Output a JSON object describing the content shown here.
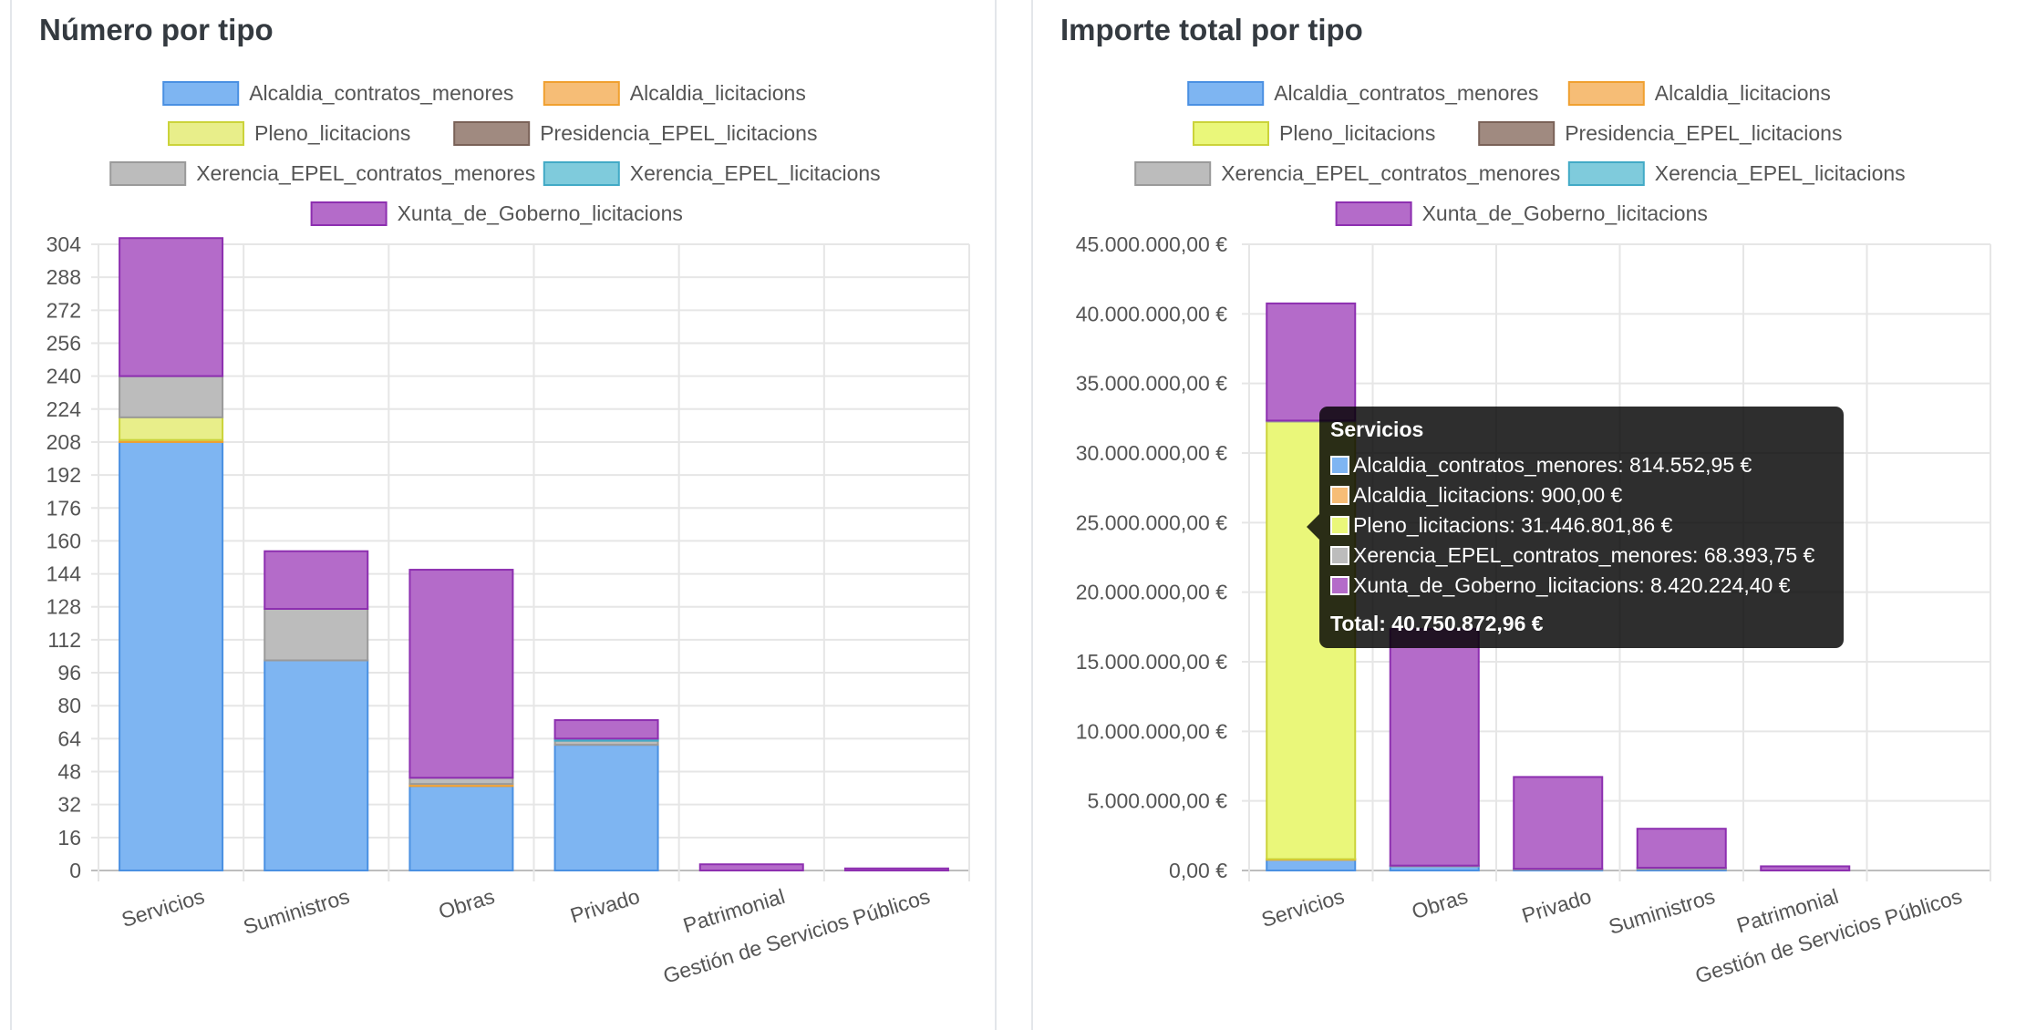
{
  "panels": {
    "left": {
      "title": "Número por tipo"
    },
    "right": {
      "title": "Importe total por tipo"
    }
  },
  "chart_data": [
    {
      "type": "bar",
      "stacked": true,
      "title": "Número por tipo",
      "categories": [
        "Servicios",
        "Suministros",
        "Obras",
        "Privado",
        "Patrimonial",
        "Gestión de Servicios Públicos"
      ],
      "ylim": [
        0,
        304
      ],
      "yticks": [
        0,
        16,
        32,
        48,
        64,
        80,
        96,
        112,
        128,
        144,
        160,
        176,
        192,
        208,
        224,
        240,
        256,
        272,
        288,
        304
      ],
      "y_tick_labels": [
        "0",
        "16",
        "32",
        "48",
        "64",
        "80",
        "96",
        "112",
        "128",
        "144",
        "160",
        "176",
        "192",
        "208",
        "224",
        "240",
        "256",
        "272",
        "288",
        "304"
      ],
      "grid": true,
      "legend_position": "top",
      "series": [
        {
          "name": "Alcaldia_contratos_menores",
          "color": "#7eb5f2",
          "border": "#4a90e2",
          "values": [
            208,
            102,
            41,
            61,
            0,
            0
          ]
        },
        {
          "name": "Alcaldia_licitacions",
          "color": "#f6bd76",
          "border": "#f0a030",
          "values": [
            1,
            0,
            1,
            0,
            0,
            0
          ]
        },
        {
          "name": "Pleno_licitacions",
          "color": "#e8ee8a",
          "border": "#cbd33a",
          "values": [
            11,
            0,
            0,
            0,
            0,
            0
          ]
        },
        {
          "name": "Presidencia_EPEL_licitacions",
          "color": "#a08a80",
          "border": "#7a6258",
          "values": [
            0,
            0,
            0,
            0,
            0,
            0
          ]
        },
        {
          "name": "Xerencia_EPEL_contratos_menores",
          "color": "#bcbcbc",
          "border": "#9a9a9a",
          "values": [
            20,
            25,
            3,
            2,
            0,
            0
          ]
        },
        {
          "name": "Xerencia_EPEL_licitacions",
          "color": "#7fcbdc",
          "border": "#42aac6",
          "values": [
            0,
            0,
            0,
            1,
            0,
            0
          ]
        },
        {
          "name": "Xunta_de_Goberno_licitacions",
          "color": "#b46bc9",
          "border": "#8d2fb0",
          "values": [
            67,
            28,
            101,
            9,
            3,
            1
          ]
        }
      ]
    },
    {
      "type": "bar",
      "stacked": true,
      "title": "Importe total por tipo",
      "categories": [
        "Servicios",
        "Obras",
        "Privado",
        "Suministros",
        "Patrimonial",
        "Gestión de Servicios Públicos"
      ],
      "ylim": [
        0,
        45000000
      ],
      "yticks": [
        0,
        5000000,
        10000000,
        15000000,
        20000000,
        25000000,
        30000000,
        35000000,
        40000000,
        45000000
      ],
      "y_tick_labels": [
        "0,00 €",
        "5.000.000,00 €",
        "10.000.000,00 €",
        "15.000.000,00 €",
        "20.000.000,00 €",
        "25.000.000,00 €",
        "30.000.000,00 €",
        "35.000.000,00 €",
        "40.000.000,00 €",
        "45.000.000,00 €"
      ],
      "grid": true,
      "legend_position": "top",
      "series": [
        {
          "name": "Alcaldia_contratos_menores",
          "color": "#7eb5f2",
          "border": "#4a90e2",
          "values": [
            814552.95,
            300000,
            100000,
            100000,
            0,
            0
          ]
        },
        {
          "name": "Alcaldia_licitacions",
          "color": "#f6bd76",
          "border": "#f0a030",
          "values": [
            900,
            0,
            0,
            0,
            0,
            0
          ]
        },
        {
          "name": "Pleno_licitacions",
          "color": "#eaf77a",
          "border": "#cbd33a",
          "values": [
            31446801.86,
            0,
            0,
            0,
            0,
            0
          ]
        },
        {
          "name": "Presidencia_EPEL_licitacions",
          "color": "#a08a80",
          "border": "#7a6258",
          "values": [
            0,
            0,
            0,
            0,
            0,
            0
          ]
        },
        {
          "name": "Xerencia_EPEL_contratos_menores",
          "color": "#bcbcbc",
          "border": "#9a9a9a",
          "values": [
            68393.75,
            50000,
            20000,
            100000,
            0,
            0
          ]
        },
        {
          "name": "Xerencia_EPEL_licitacions",
          "color": "#7fcbdc",
          "border": "#42aac6",
          "values": [
            0,
            0,
            0,
            0,
            0,
            0
          ]
        },
        {
          "name": "Xunta_de_Goberno_licitacions",
          "color": "#b46bc9",
          "border": "#8d2fb0",
          "values": [
            8420224.4,
            17000000,
            6600000,
            2800000,
            300000,
            0
          ]
        }
      ]
    }
  ],
  "tooltip": {
    "title": "Servicios",
    "items": [
      {
        "label": "Alcaldia_contratos_menores: 814.552,95 €",
        "color": "#7eb5f2"
      },
      {
        "label": "Alcaldia_licitacions: 900,00 €",
        "color": "#f6bd76"
      },
      {
        "label": "Pleno_licitacions: 31.446.801,86 €",
        "color": "#eaf77a"
      },
      {
        "label": "Xerencia_EPEL_contratos_menores: 68.393,75 €",
        "color": "#bcbcbc"
      },
      {
        "label": "Xunta_de_Goberno_licitacions: 8.420.224,40 €",
        "color": "#b46bc9"
      }
    ],
    "footer": "Total: 40.750.872,96 €"
  }
}
